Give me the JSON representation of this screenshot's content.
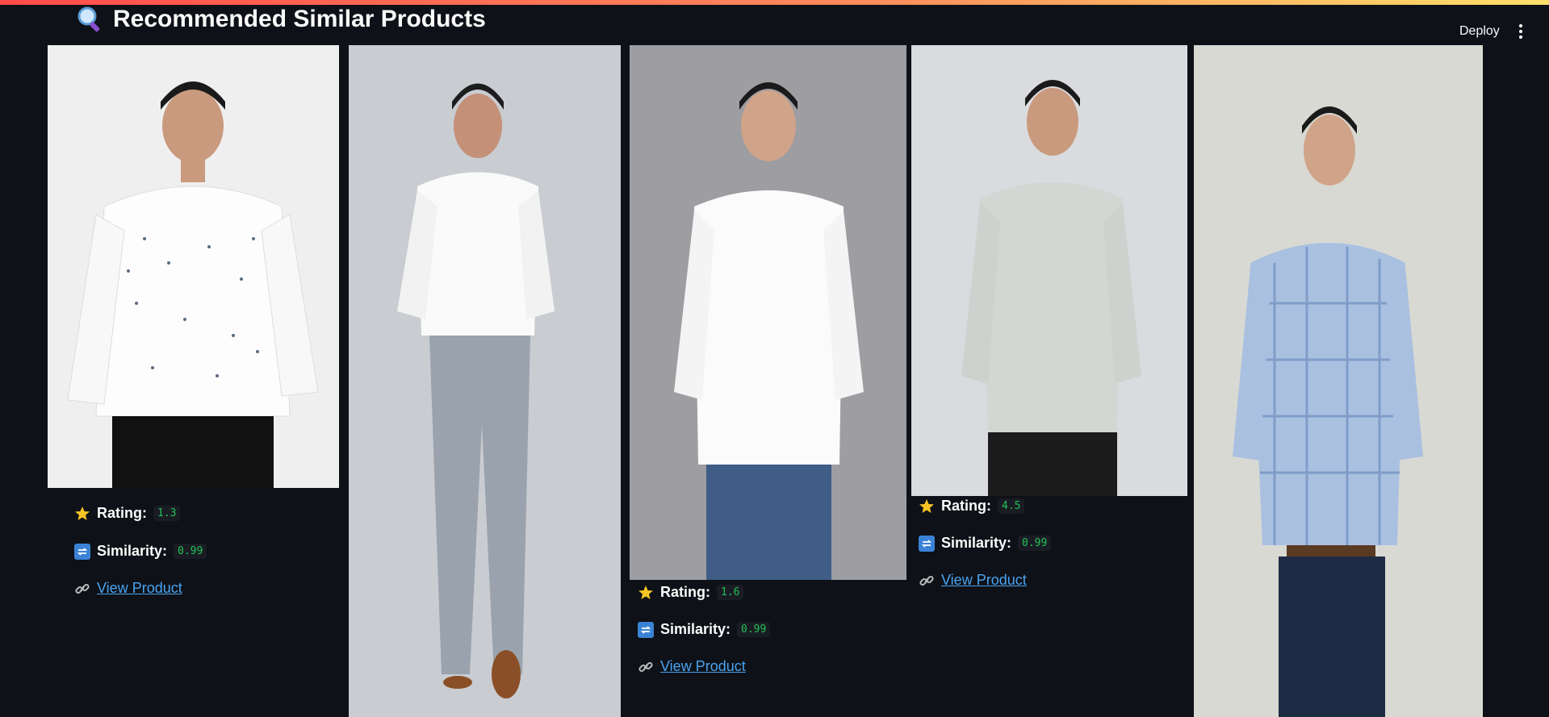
{
  "app": {
    "title": "Recommended Similar Products",
    "deploy_label": "Deploy",
    "title_icon": "magnifying-glass-icon",
    "menu_icon": "kebab-menu-icon"
  },
  "labels": {
    "rating": "Rating:",
    "similarity": "Similarity:",
    "view_product": "View Product"
  },
  "products": [
    {
      "name": "white printed shirt",
      "rating": "1.3",
      "similarity": "0.99"
    },
    {
      "name": "white shirt grey trousers",
      "rating": "",
      "similarity": ""
    },
    {
      "name": "white mandarin collar shirt",
      "rating": "1.6",
      "similarity": "0.99"
    },
    {
      "name": "light grey shirt",
      "rating": "4.5",
      "similarity": "0.99"
    },
    {
      "name": "blue check shirt",
      "rating": "",
      "similarity": ""
    }
  ],
  "colors": {
    "background": "#0e1117",
    "link": "#4aa3f0",
    "code_text": "#21c354",
    "accent_top": "#ff4b4b"
  }
}
